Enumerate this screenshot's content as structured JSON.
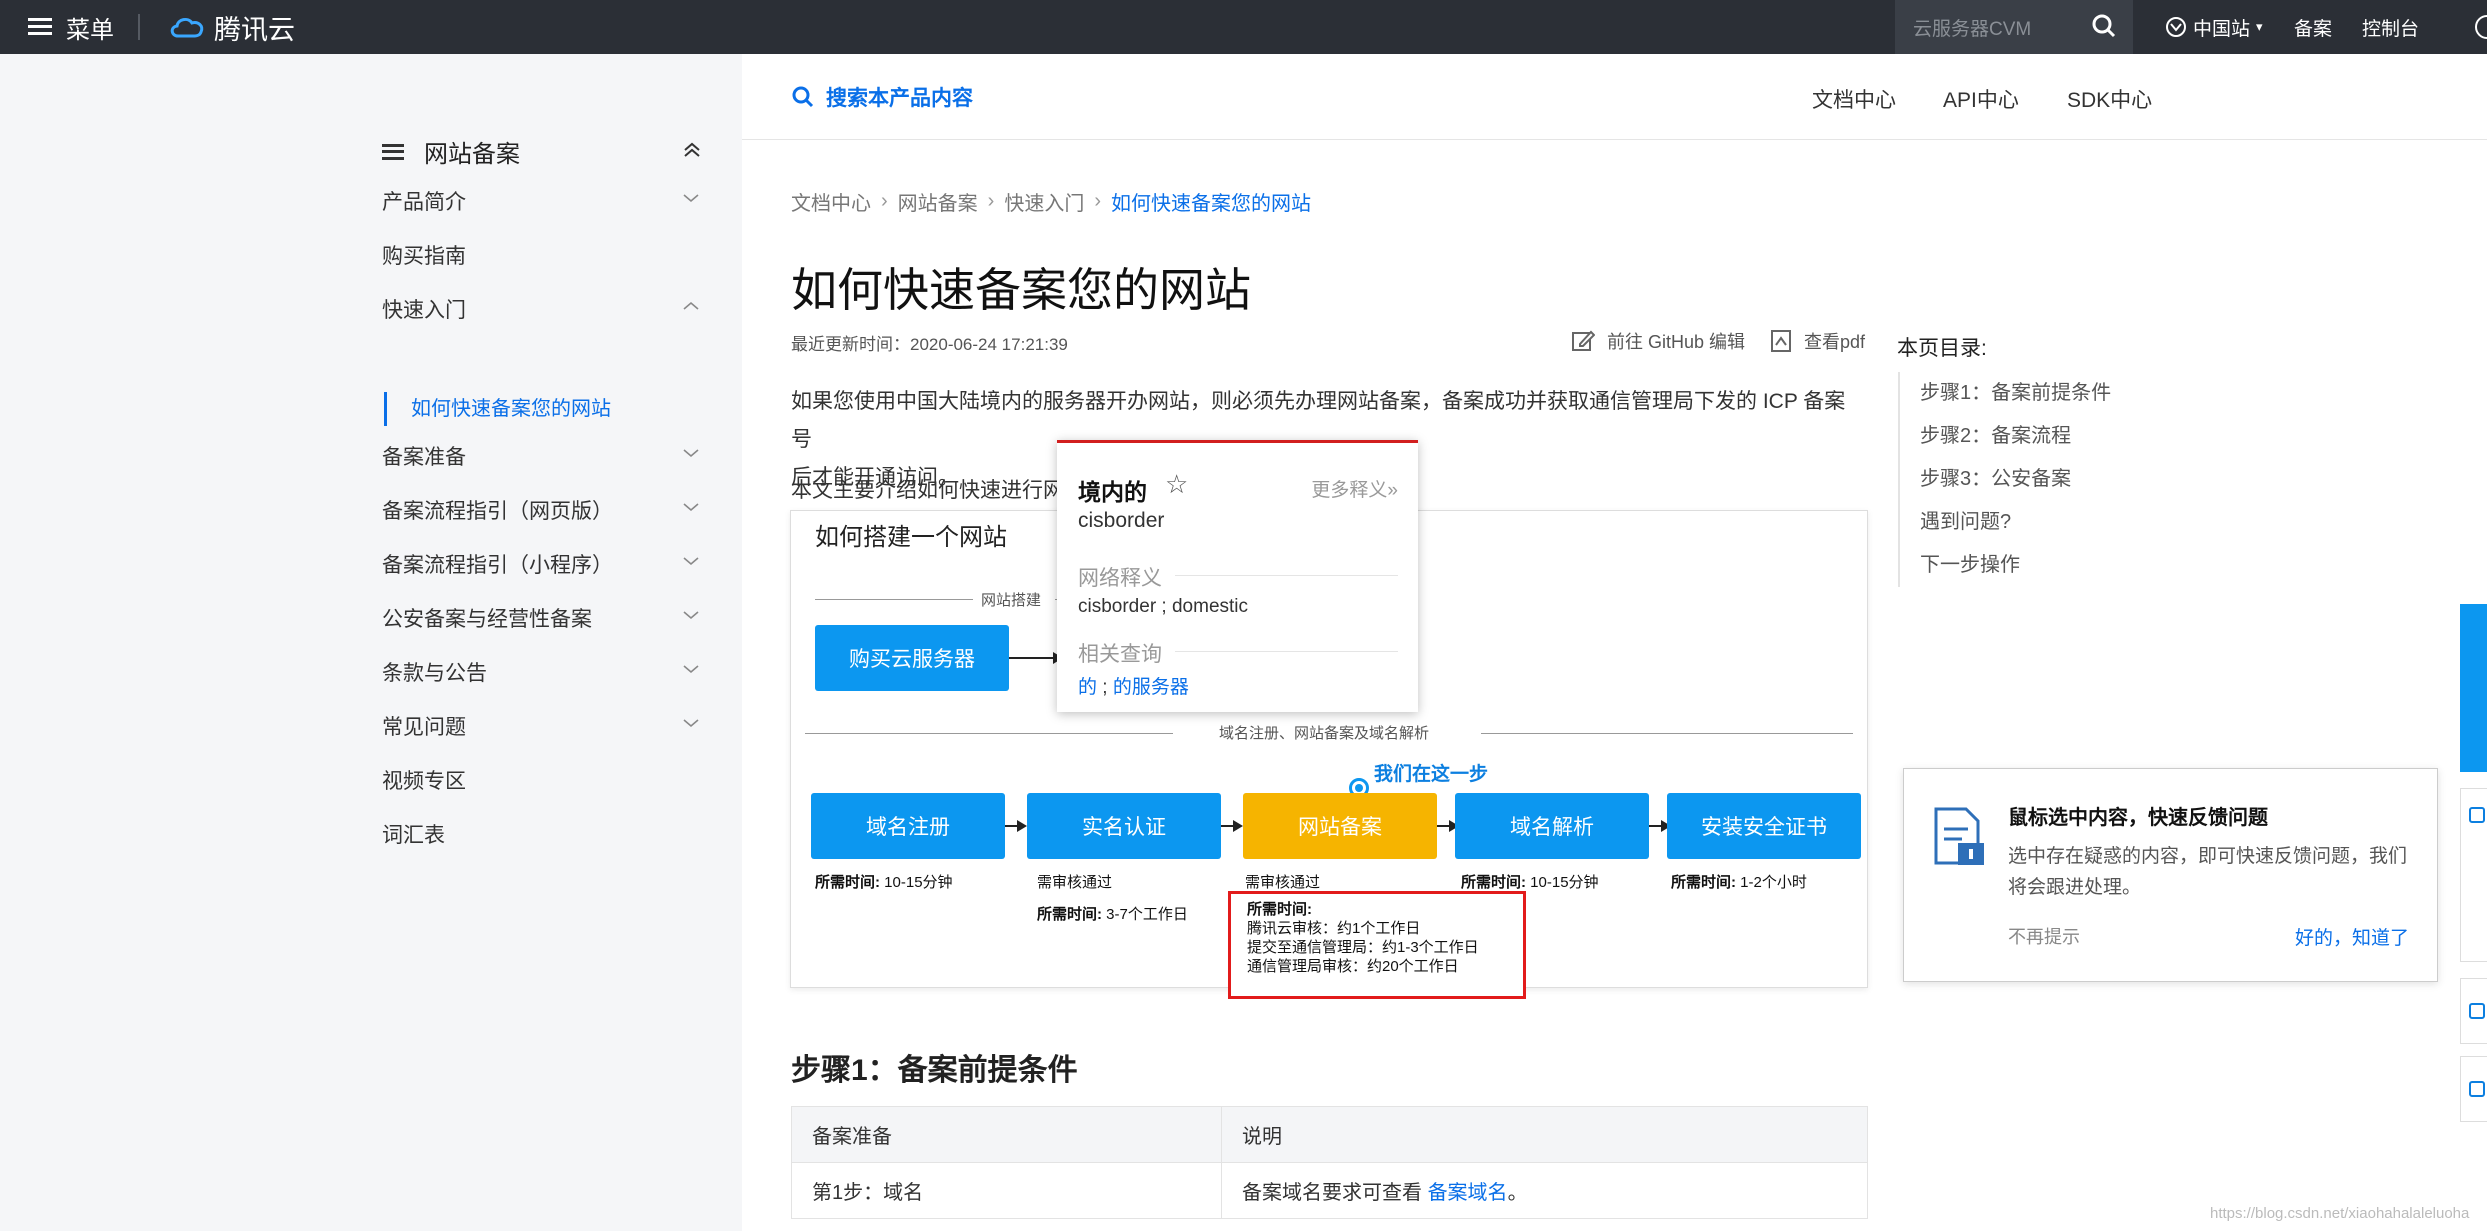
{
  "topbar": {
    "menu_label": "菜单",
    "brand": "腾讯云",
    "search_placeholder": "云服务器CVM",
    "region": "中国站",
    "links": [
      "备案",
      "控制台"
    ]
  },
  "sidebar": {
    "title": "网站备案",
    "items": [
      {
        "label": "产品简介",
        "expanded": false
      },
      {
        "label": "购买指南"
      },
      {
        "label": "快速入门",
        "expanded": true
      },
      {
        "label": "备案准备",
        "expanded": false
      },
      {
        "label": "备案流程指引（网页版）",
        "expanded": false
      },
      {
        "label": "备案流程指引（小程序）",
        "expanded": false
      },
      {
        "label": "公安备案与经营性备案",
        "expanded": false
      },
      {
        "label": "条款与公告",
        "expanded": false
      },
      {
        "label": "常见问题",
        "expanded": false
      },
      {
        "label": "视频专区"
      },
      {
        "label": "词汇表"
      }
    ],
    "active_sub": "如何快速备案您的网站"
  },
  "header": {
    "search_label": "搜索本产品内容",
    "links": [
      "文档中心",
      "API中心",
      "SDK中心"
    ]
  },
  "breadcrumb": [
    "文档中心",
    "网站备案",
    "快速入门",
    "如何快速备案您的网站"
  ],
  "article": {
    "title": "如何快速备案您的网站",
    "updated": "最近更新时间：2020-06-24 17:21:39",
    "github_edit": "前往 GitHub 编辑",
    "view_pdf": "查看pdf",
    "para1_line1": "如果您使用中国大陆境内的服务器开办网站，则必须先办理网站备案，备案成功并获取通信管理局下发的 ICP 备案号",
    "para1_line2": "后才能开通访问。",
    "para2": "本文主要介绍如何快速进行网"
  },
  "diagram": {
    "title": "如何搭建一个网站",
    "section1": "网站搭建",
    "section2": "域名注册、网站备案及域名解析",
    "buy_server": "购买云服务器",
    "we_are_here": "我们在这一步",
    "steps": [
      {
        "label": "域名注册",
        "note1": "",
        "note2_bold": "所需时间:",
        "note2": " 10-15分钟"
      },
      {
        "label": "实名认证",
        "note1": "需审核通过",
        "note2_bold": "所需时间:",
        "note2": " 3-7个工作日"
      },
      {
        "label": "网站备案",
        "note1": "需审核通过",
        "note2_bold": "",
        "note2": ""
      },
      {
        "label": "域名解析",
        "note1": "",
        "note2_bold": "所需时间:",
        "note2": " 10-15分钟"
      },
      {
        "label": "安装安全证书",
        "note1": "",
        "note2_bold": "所需时间:",
        "note2": " 1-2个小时"
      }
    ],
    "time_box": {
      "title": "所需时间:",
      "lines": [
        "腾讯云审核：约1个工作日",
        "提交至通信管理局：约1-3个工作日",
        "通信管理局审核：约20个工作日"
      ]
    }
  },
  "popup": {
    "word": "境内的",
    "star": "☆",
    "more": "更多释义»",
    "pronunciation": "cisborder",
    "net_label": "网络释义",
    "net_text": "cisborder ; domestic",
    "related_label": "相关查询",
    "related_a": "的",
    "related_sep": " ; ",
    "related_b": "的服务器"
  },
  "toc": {
    "title": "本页目录:",
    "items": [
      "步骤1：备案前提条件",
      "步骤2：备案流程",
      "步骤3：公安备案",
      "遇到问题?",
      "下一步操作"
    ]
  },
  "step1": {
    "title": "步骤1：备案前提条件",
    "table": {
      "headers": [
        "备案准备",
        "说明"
      ],
      "row1": {
        "c1": "第1步：域名",
        "c2_text": "备案域名要求可查看 ",
        "c2_link": "备案域名",
        "c2_end": "。"
      }
    }
  },
  "feedback": {
    "title": "鼠标选中内容，快速反馈问题",
    "desc": "选中存在疑惑的内容，即可快速反馈问题，我们将会跟进处理。",
    "dismiss": "不再提示",
    "ok": "好的，知道了"
  },
  "watermark": "https://blog.csdn.net/xiaohahalaleluoha",
  "colors": {
    "accent": "#0a6fe8",
    "topbar": "#2b2f36",
    "step_blue": "#0c97f0",
    "step_yellow": "#f6b400",
    "highlight_red": "#e21b1b"
  }
}
